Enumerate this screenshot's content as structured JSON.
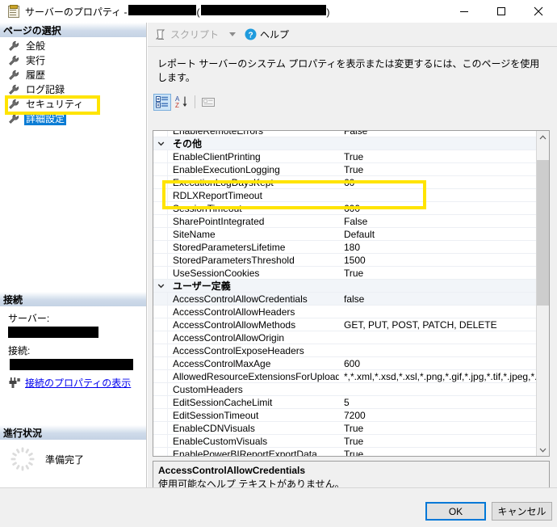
{
  "window": {
    "title_prefix": "サーバーのプロパティ -",
    "title_redacted_1": "",
    "title_redacted_2": "",
    "title_paren_open": "(",
    "title_paren_close": ")",
    "icon": "server-properties-icon",
    "minimize_label": "–",
    "maximize_label": "□",
    "close_label": "✕"
  },
  "sidebar": {
    "page_select_header": "ページの選択",
    "items": [
      {
        "label": "全般",
        "selected": false
      },
      {
        "label": "実行",
        "selected": false
      },
      {
        "label": "履歴",
        "selected": false
      },
      {
        "label": "ログ記録",
        "selected": false
      },
      {
        "label": "セキュリティ",
        "selected": false
      },
      {
        "label": "詳細設定",
        "selected": true
      }
    ],
    "connection_header": "接続",
    "server_label": "サーバー:",
    "server_value_redacted": "",
    "connection_label": "接続:",
    "connection_value_redacted": "",
    "view_connection_properties_link": "接続のプロパティの表示",
    "progress_header": "進行状況",
    "progress_status": "準備完了"
  },
  "toolbar": {
    "script_label": "スクリプト",
    "help_label": "ヘルプ"
  },
  "main": {
    "description": "レポート サーバーのシステム プロパティを表示または変更するには、このページを使用します。",
    "grid_toolbar": {
      "categorized_title": "カテゴリ別",
      "alphabetical_title": "アルファベット順",
      "property_pages_title": "プロパティ ページ"
    },
    "rows": [
      {
        "type": "property",
        "name": "EnableRemoteErrors",
        "value": "False",
        "shaded": false
      },
      {
        "type": "category",
        "name": "その他",
        "value": "",
        "shaded": true
      },
      {
        "type": "property",
        "name": "EnableClientPrinting",
        "value": "True",
        "shaded": false
      },
      {
        "type": "property",
        "name": "EnableExecutionLogging",
        "value": "True",
        "shaded": false
      },
      {
        "type": "property",
        "name": "ExecutionLogDaysKept",
        "value": "60",
        "shaded": false
      },
      {
        "type": "property",
        "name": "RDLXReportTimeout",
        "value": "",
        "shaded": false
      },
      {
        "type": "property",
        "name": "SessionTimeout",
        "value": "600",
        "shaded": false
      },
      {
        "type": "property",
        "name": "SharePointIntegrated",
        "value": "False",
        "shaded": false
      },
      {
        "type": "property",
        "name": "SiteName",
        "value": "Default",
        "shaded": false
      },
      {
        "type": "property",
        "name": "StoredParametersLifetime",
        "value": "180",
        "shaded": false
      },
      {
        "type": "property",
        "name": "StoredParametersThreshold",
        "value": "1500",
        "shaded": false
      },
      {
        "type": "property",
        "name": "UseSessionCookies",
        "value": "True",
        "shaded": false
      },
      {
        "type": "category",
        "name": "ユーザー定義",
        "value": "",
        "shaded": true
      },
      {
        "type": "property",
        "name": "AccessControlAllowCredentials",
        "value": "false",
        "shaded": true
      },
      {
        "type": "property",
        "name": "AccessControlAllowHeaders",
        "value": "",
        "shaded": false
      },
      {
        "type": "property",
        "name": "AccessControlAllowMethods",
        "value": "GET, PUT, POST, PATCH, DELETE",
        "shaded": false
      },
      {
        "type": "property",
        "name": "AccessControlAllowOrigin",
        "value": "",
        "shaded": false
      },
      {
        "type": "property",
        "name": "AccessControlExposeHeaders",
        "value": "",
        "shaded": false
      },
      {
        "type": "property",
        "name": "AccessControlMaxAge",
        "value": "600",
        "shaded": false
      },
      {
        "type": "property",
        "name": "AllowedResourceExtensionsForUpload",
        "value": "*,*.xml,*.xsd,*.xsl,*.png,*.gif,*.jpg,*.tif,*.jpeg,*.tiff,*.b",
        "shaded": false
      },
      {
        "type": "property",
        "name": "CustomHeaders",
        "value": "",
        "shaded": false
      },
      {
        "type": "property",
        "name": "EditSessionCacheLimit",
        "value": "5",
        "shaded": false
      },
      {
        "type": "property",
        "name": "EditSessionTimeout",
        "value": "7200",
        "shaded": false
      },
      {
        "type": "property",
        "name": "EnableCDNVisuals",
        "value": "True",
        "shaded": false
      },
      {
        "type": "property",
        "name": "EnableCustomVisuals",
        "value": "True",
        "shaded": false
      },
      {
        "type": "property",
        "name": "EnablePowerBIReportExportData",
        "value": "True",
        "shaded": false
      }
    ],
    "selected_row_index": 13,
    "description_pane": {
      "title": "AccessControlAllowCredentials",
      "body": "使用可能なヘルプ テキストがありません。"
    }
  },
  "footer": {
    "ok_label": "OK",
    "cancel_label": "キャンセル"
  },
  "annotations": {
    "highlight_color": "#ffe400",
    "sidebar_highlight_target": "詳細設定",
    "grid_highlight_target": "SessionTimeout"
  }
}
